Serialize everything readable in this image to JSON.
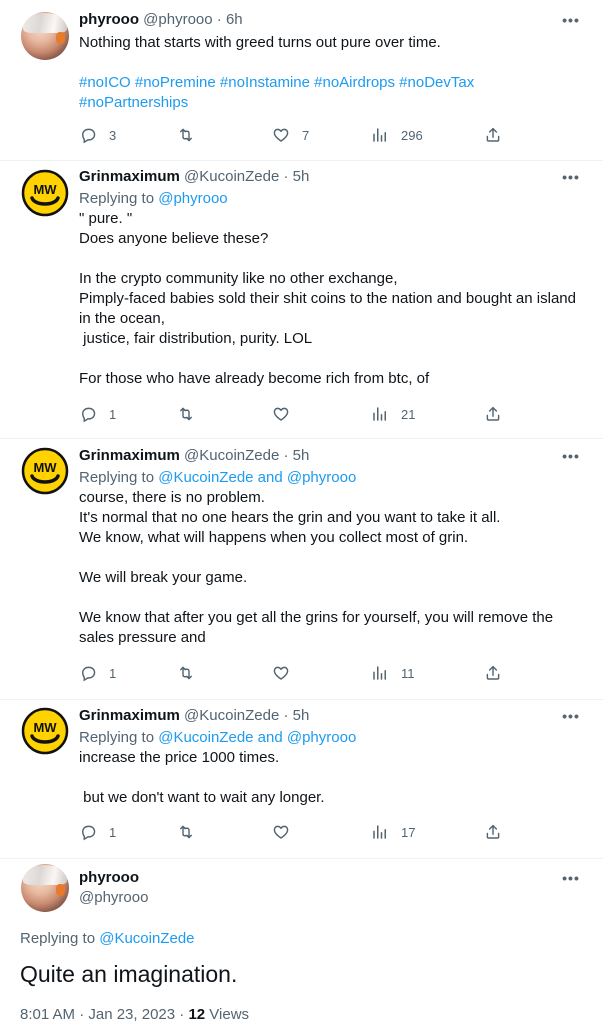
{
  "tweets": [
    {
      "name": "phyrooo",
      "handle": "@phyrooo",
      "time": "6h",
      "lines": [
        "Nothing that starts with greed turns out pure over time."
      ],
      "hashtags_line1": "#noICO #noPremine #noInstamine #noAirdrops #noDevTax",
      "hashtags_line2": "#noPartnerships",
      "replies": "3",
      "retweets": "",
      "likes": "7",
      "views": "296"
    },
    {
      "name": "Grinmaximum",
      "handle": "@KucoinZede",
      "time": "5h",
      "replying_prefix": "Replying to ",
      "replying_to": "@phyrooo",
      "lines": [
        "\" pure. \"",
        "Does anyone believe these?",
        "",
        "In the crypto community like no other exchange,",
        "Pimply-faced babies sold their shit coins to the nation and bought an island",
        "in the ocean,",
        " justice, fair distribution, purity. LOL",
        "",
        "For those who have already become rich from btc, of"
      ],
      "replies": "1",
      "retweets": "",
      "likes": "",
      "views": "21"
    },
    {
      "name": "Grinmaximum",
      "handle": "@KucoinZede",
      "time": "5h",
      "replying_prefix": "Replying to ",
      "replying_to": "@KucoinZede and @phyrooo",
      "lines": [
        "course, there is no problem.",
        "It's normal that no one hears the grin and you want to take it all.",
        "We know, what will happens when you collect most of grin.",
        "",
        "We will break your game.",
        "",
        "We know that after you get all the grins for yourself, you will remove the",
        "sales pressure and"
      ],
      "replies": "1",
      "retweets": "",
      "likes": "",
      "views": "11"
    },
    {
      "name": "Grinmaximum",
      "handle": "@KucoinZede",
      "time": "5h",
      "replying_prefix": "Replying to ",
      "replying_to": "@KucoinZede and @phyrooo",
      "lines": [
        "increase the price 1000 times.",
        "",
        " but we don't want to wait any longer."
      ],
      "replies": "1",
      "retweets": "",
      "likes": "",
      "views": "17"
    }
  ],
  "main_tweet": {
    "name": "phyrooo",
    "handle": "@phyrooo",
    "replying_prefix": "Replying to ",
    "replying_to": "@KucoinZede",
    "text": "Quite an imagination.",
    "timestamp": "8:01 AM · Jan 23, 2023 · ",
    "views_count": "12",
    "views_label": " Views"
  },
  "separator": "·",
  "more_glyph": "•••",
  "icons": {
    "reply": "reply-icon",
    "retweet": "retweet-icon",
    "like": "heart-icon",
    "views": "views-chart-icon",
    "share": "share-icon"
  },
  "colors": {
    "text": "#0f1419",
    "secondary": "#536471",
    "link": "#1d9bf0",
    "divider": "#eff3f4",
    "grin_avatar": "#ffd200"
  }
}
